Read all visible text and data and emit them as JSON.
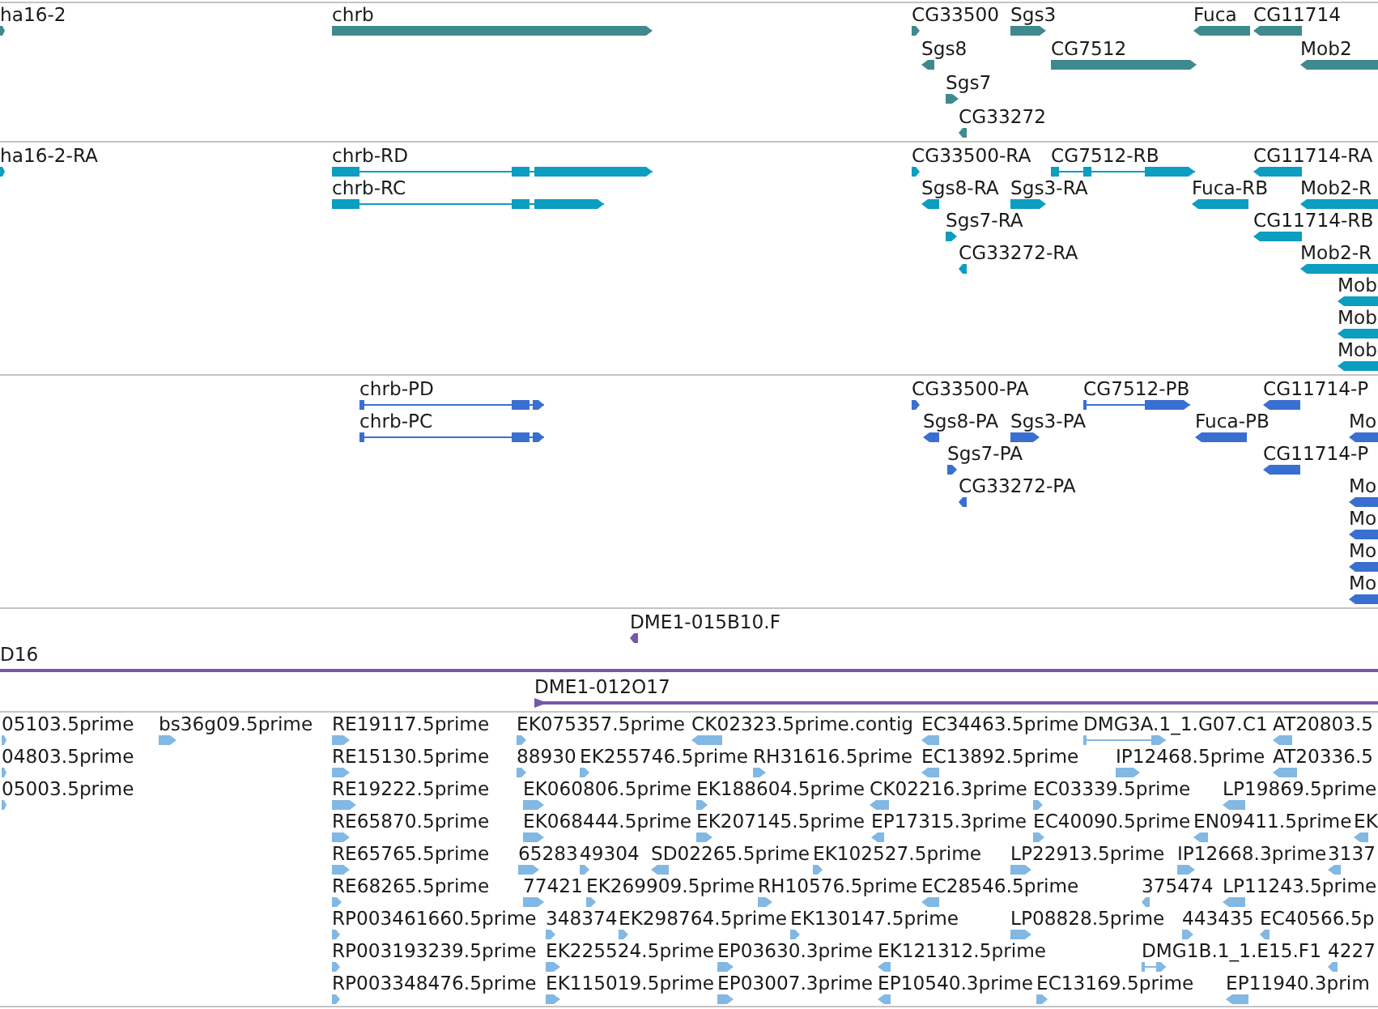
{
  "tracks": [
    {
      "kind": "gene",
      "lanes": [
        {
          "features": [
            {
              "label": "ha16-2",
              "reverse": false
            },
            {
              "label": "chrb",
              "reverse": false
            },
            {
              "label": "CG33500",
              "reverse": false
            },
            {
              "label": "Sgs3",
              "reverse": false
            },
            {
              "label": "Fuca",
              "reverse": true
            },
            {
              "label": "CG11714",
              "reverse": true
            }
          ]
        },
        {
          "features": [
            {
              "label": "Sgs8",
              "reverse": true
            },
            {
              "label": "CG7512",
              "reverse": false
            },
            {
              "label": "Mob2",
              "reverse": true
            }
          ]
        },
        {
          "features": [
            {
              "label": "Sgs7",
              "reverse": false
            }
          ]
        },
        {
          "features": [
            {
              "label": "CG33272",
              "reverse": true
            }
          ]
        }
      ]
    },
    {
      "kind": "transcript",
      "lanes": [
        {
          "features": [
            {
              "label": "ha16-2-RA",
              "reverse": false
            },
            {
              "label": "chrb-RD",
              "reverse": false
            },
            {
              "label": "CG33500-RA",
              "reverse": false
            },
            {
              "label": "CG7512-RB",
              "reverse": false
            },
            {
              "label": "CG11714-RA",
              "reverse": true
            }
          ]
        },
        {
          "features": [
            {
              "label": "chrb-RC",
              "reverse": false
            },
            {
              "label": "Sgs8-RA",
              "reverse": true
            },
            {
              "label": "Sgs3-RA",
              "reverse": false
            },
            {
              "label": "Fuca-RB",
              "reverse": true
            },
            {
              "label": "Mob2-R",
              "reverse": true
            }
          ]
        },
        {
          "features": [
            {
              "label": "Sgs7-RA",
              "reverse": false
            },
            {
              "label": "CG11714-RB",
              "reverse": true
            }
          ]
        },
        {
          "features": [
            {
              "label": "CG33272-RA",
              "reverse": true
            },
            {
              "label": "Mob2-R",
              "reverse": true
            }
          ]
        },
        {
          "features": [
            {
              "label": "Mob",
              "reverse": true
            }
          ]
        },
        {
          "features": [
            {
              "label": "Mob",
              "reverse": true
            }
          ]
        },
        {
          "features": [
            {
              "label": "Mob",
              "reverse": true
            }
          ]
        }
      ]
    },
    {
      "kind": "protein",
      "lanes": [
        {
          "features": [
            {
              "label": "chrb-PD",
              "reverse": false
            },
            {
              "label": "CG33500-PA",
              "reverse": false
            },
            {
              "label": "CG7512-PB",
              "reverse": false
            },
            {
              "label": "CG11714-P",
              "reverse": true
            }
          ]
        },
        {
          "features": [
            {
              "label": "chrb-PC",
              "reverse": false
            },
            {
              "label": "Sgs8-PA",
              "reverse": true
            },
            {
              "label": "Sgs3-PA",
              "reverse": false
            },
            {
              "label": "Fuca-PB",
              "reverse": true
            },
            {
              "label": "Mo",
              "reverse": true
            }
          ]
        },
        {
          "features": [
            {
              "label": "Sgs7-PA",
              "reverse": false
            },
            {
              "label": "CG11714-P",
              "reverse": true
            }
          ]
        },
        {
          "features": [
            {
              "label": "CG33272-PA",
              "reverse": true
            },
            {
              "label": "Mo",
              "reverse": true
            }
          ]
        },
        {
          "features": [
            {
              "label": "Mo",
              "reverse": true
            }
          ]
        },
        {
          "features": [
            {
              "label": "Mo",
              "reverse": true
            }
          ]
        },
        {
          "features": [
            {
              "label": "Mo",
              "reverse": true
            }
          ]
        }
      ]
    },
    {
      "kind": "clone",
      "lanes": [
        {
          "features": [
            {
              "label": "DME1-015B10.F",
              "reverse": true
            }
          ]
        },
        {
          "features": [
            {
              "label": "D16"
            }
          ]
        },
        {
          "features": [
            {
              "label": "DME1-012O17",
              "reverse": false
            }
          ]
        }
      ]
    },
    {
      "kind": "est",
      "lanes": [
        {
          "features": [
            {
              "label": "05103.5prime",
              "reverse": false
            },
            {
              "label": "bs36g09.5prime",
              "reverse": false
            },
            {
              "label": "RE19117.5prime",
              "reverse": false
            },
            {
              "label": "EK075357.5prime",
              "reverse": false
            },
            {
              "label": "CK02323.5prime.contig",
              "reverse": true
            },
            {
              "label": "EC34463.5prime",
              "reverse": true
            },
            {
              "label": "DMG3A.1_1.G07.C1",
              "reverse": false
            },
            {
              "label": "AT20803.5",
              "reverse": true
            }
          ]
        },
        {
          "features": [
            {
              "label": "04803.5prime",
              "reverse": false
            },
            {
              "label": "RE15130.5prime",
              "reverse": false
            },
            {
              "label": "88930",
              "reverse": false
            },
            {
              "label": "EK255746.5prime",
              "reverse": false
            },
            {
              "label": "RH31616.5prime",
              "reverse": false
            },
            {
              "label": "EC13892.5prime",
              "reverse": true
            },
            {
              "label": "IP12468.5prime",
              "reverse": false
            },
            {
              "label": "AT20336.5",
              "reverse": true
            }
          ]
        },
        {
          "features": [
            {
              "label": "05003.5prime",
              "reverse": false
            },
            {
              "label": "RE19222.5prime",
              "reverse": false
            },
            {
              "label": "EK060806.5prime",
              "reverse": false
            },
            {
              "label": "EK188604.5prime",
              "reverse": false
            },
            {
              "label": "CK02216.3prime",
              "reverse": true
            },
            {
              "label": "EC03339.5prime",
              "reverse": false
            },
            {
              "label": "LP19869.5prime",
              "reverse": true
            }
          ]
        },
        {
          "features": [
            {
              "label": "RE65870.5prime",
              "reverse": false
            },
            {
              "label": "EK068444.5prime",
              "reverse": false
            },
            {
              "label": "EK207145.5prime",
              "reverse": false
            },
            {
              "label": "EP17315.3prime",
              "reverse": true
            },
            {
              "label": "EC40090.5prime",
              "reverse": false
            },
            {
              "label": "EN09411.5prime",
              "reverse": true
            },
            {
              "label": "EK",
              "reverse": true
            }
          ]
        },
        {
          "features": [
            {
              "label": "RE65765.5prime",
              "reverse": false
            },
            {
              "label": "65283",
              "reverse": false
            },
            {
              "label": "49304",
              "reverse": false
            },
            {
              "label": "SD02265.5prime",
              "reverse": true
            },
            {
              "label": "EK102527.5prime",
              "reverse": false
            },
            {
              "label": "LP22913.5prime",
              "reverse": false
            },
            {
              "label": "IP12668.3prime",
              "reverse": false
            },
            {
              "label": "3137",
              "reverse": true
            }
          ]
        },
        {
          "features": [
            {
              "label": "RE68265.5prime",
              "reverse": false
            },
            {
              "label": "77421",
              "reverse": false
            },
            {
              "label": "EK269909.5prime",
              "reverse": false
            },
            {
              "label": "RH10576.5prime",
              "reverse": false
            },
            {
              "label": "EC28546.5prime",
              "reverse": true
            },
            {
              "label": "375474",
              "reverse": true
            },
            {
              "label": "LP11243.5prime",
              "reverse": true
            }
          ]
        },
        {
          "features": [
            {
              "label": "RP003461660.5prime",
              "reverse": false
            },
            {
              "label": "348374",
              "reverse": false
            },
            {
              "label": "EK298764.5prime",
              "reverse": false
            },
            {
              "label": "EK130147.5prime",
              "reverse": false
            },
            {
              "label": "LP08828.5prime",
              "reverse": false
            },
            {
              "label": "443435",
              "reverse": false
            },
            {
              "label": "EC40566.5p",
              "reverse": true
            }
          ]
        },
        {
          "features": [
            {
              "label": "RP003193239.5prime",
              "reverse": false
            },
            {
              "label": "EK225524.5prime",
              "reverse": false
            },
            {
              "label": "EP03630.3prime",
              "reverse": false
            },
            {
              "label": "EK121312.5prime",
              "reverse": true
            },
            {
              "label": "DMG1B.1_1.E15.F1",
              "reverse": false
            },
            {
              "label": "4227",
              "reverse": true
            }
          ]
        },
        {
          "features": [
            {
              "label": "RP003348476.5prime",
              "reverse": false
            },
            {
              "label": "EK115019.5prime",
              "reverse": false
            },
            {
              "label": "EP03007.3prime",
              "reverse": false
            },
            {
              "label": "EP10540.3prime",
              "reverse": true
            },
            {
              "label": "EC13169.5prime",
              "reverse": false
            },
            {
              "label": "EP11940.3prim",
              "reverse": true
            }
          ]
        }
      ]
    }
  ]
}
